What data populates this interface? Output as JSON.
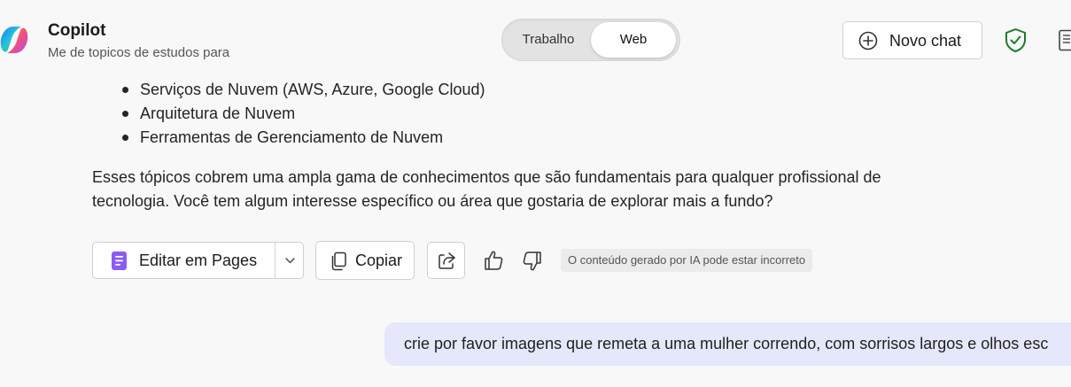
{
  "header": {
    "title": "Copilot",
    "subtitle": "Me de topicos de estudos para",
    "mode_toggle": {
      "options": [
        "Trabalho",
        "Web"
      ],
      "selected": "Web"
    },
    "new_chat_label": "Novo chat",
    "icons": [
      "copilot-logo-icon",
      "plus-circle-icon",
      "shield-check-icon",
      "notebook-icon"
    ]
  },
  "response": {
    "list_items": [
      "Serviços de Nuvem (AWS, Azure, Google Cloud)",
      "Arquitetura de Nuvem",
      "Ferramentas de Gerenciamento de Nuvem"
    ],
    "paragraph": "Esses tópicos cobrem uma ampla gama de conhecimentos que são fundamentais para qualquer profissional de tecnologia. Você tem algum interesse específico ou área que gostaria de explorar mais a fundo?"
  },
  "actions": {
    "edit_in_pages_label": "Editar em Pages",
    "copy_label": "Copiar",
    "disclaimer": "O conteúdo gerado por IA pode estar incorreto",
    "icons": [
      "pages-icon",
      "chevron-down-icon",
      "copy-icon",
      "share-icon",
      "thumbs-up-icon",
      "thumbs-down-icon"
    ]
  },
  "user_message": {
    "text": "crie por favor imagens que remeta a uma mulher correndo, com sorrisos largos e olhos esc"
  },
  "colors": {
    "background": "#f8f8f8",
    "user_bubble": "#e5e8fb",
    "pages_purple": "#8a5cf5",
    "shield_green": "#1e7a2e"
  }
}
